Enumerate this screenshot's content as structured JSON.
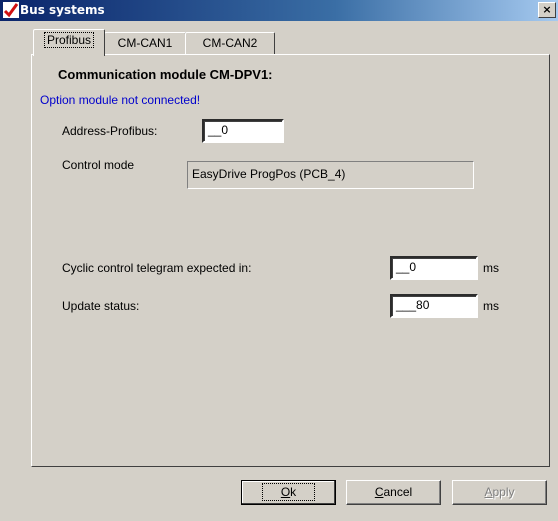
{
  "window": {
    "title": "Bus systems",
    "close_glyph": "×",
    "icon": "red-check-icon"
  },
  "tabs": [
    {
      "label": "Profibus",
      "active": true
    },
    {
      "label": "CM-CAN1",
      "active": false
    },
    {
      "label": "CM-CAN2",
      "active": false
    }
  ],
  "profibus": {
    "heading": "Communication module CM-DPV1:",
    "warning": "Option module not connected!",
    "address_label": "Address-Profibus:",
    "address_value": "__0",
    "control_mode_label": "Control mode",
    "control_mode_value": "EasyDrive ProgPos   (PCB_4)",
    "cyclic_label": "Cyclic control telegram expected in:",
    "cyclic_value": "__0",
    "cyclic_unit": "ms",
    "update_label": "Update status:",
    "update_value": "___80",
    "update_unit": "ms"
  },
  "buttons": {
    "ok_mnemonic": "O",
    "ok_rest": "k",
    "cancel_mnemonic": "C",
    "cancel_rest": "ancel",
    "apply_mnemonic": "A",
    "apply_rest": "pply"
  },
  "colors": {
    "warning": "#0000cc",
    "titlebar_start": "#0a246a",
    "titlebar_end": "#a6caf0"
  }
}
